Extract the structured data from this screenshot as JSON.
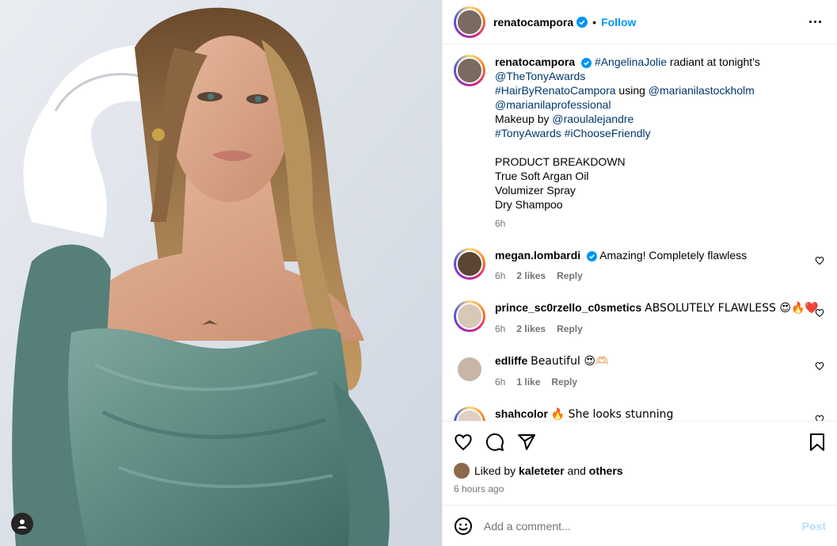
{
  "post": {
    "author": "renatocampora",
    "follow_label": "Follow",
    "separator": "•",
    "caption": {
      "username": "renatocampora",
      "line1_hashtag": "#AngelinaJolie",
      "line1_text": " radiant at tonight's",
      "line2": "@TheTonyAwards",
      "line3_hashtag": "#HairByRenatoCampora",
      "line3_text": " using ",
      "line3_mention": "@marianilastockholm",
      "line4": "@marianilaprofessional",
      "line5_text": "Makeup by ",
      "line5_mention": "@raoulalejandre",
      "line6": "#TonyAwards #iChooseFriendly",
      "line7": "PRODUCT BREAKDOWN",
      "line8": "True Soft Argan Oil",
      "line9": "Volumizer Spray",
      "line10": "Dry Shampoo",
      "time": "6h"
    },
    "comments": [
      {
        "username": "megan.lombardi",
        "verified": true,
        "text": "Amazing! Completely flawless",
        "time": "6h",
        "likes": "2 likes",
        "reply": "Reply"
      },
      {
        "username": "prince_sc0rzello_c0smetics",
        "verified": false,
        "text": "ABSOLUTELY FLAWLESS 😍🔥❤️",
        "time": "6h",
        "likes": "2 likes",
        "reply": "Reply"
      },
      {
        "username": "edliffe",
        "verified": false,
        "text": "Beautiful 😍🫶🏻",
        "time": "6h",
        "likes": "1 like",
        "reply": "Reply"
      },
      {
        "username": "shahcolor",
        "verified": false,
        "text": "🔥 She looks stunning",
        "time": "",
        "likes": "",
        "reply": ""
      }
    ],
    "liked_by": {
      "prefix": "Liked by ",
      "user": "kaleteter",
      "and": " and ",
      "others": "others"
    },
    "posted_ago": "6 hours ago",
    "add_comment": {
      "placeholder": "Add a comment...",
      "post_label": "Post"
    }
  },
  "colors": {
    "accent": "#0095f6",
    "link": "#00376b",
    "muted": "#737373",
    "verified": "#0095f6"
  },
  "icons": [
    "more-icon",
    "verified-icon",
    "heart-icon",
    "comment-icon",
    "share-icon",
    "save-icon",
    "emoji-icon",
    "user-tag-icon"
  ]
}
